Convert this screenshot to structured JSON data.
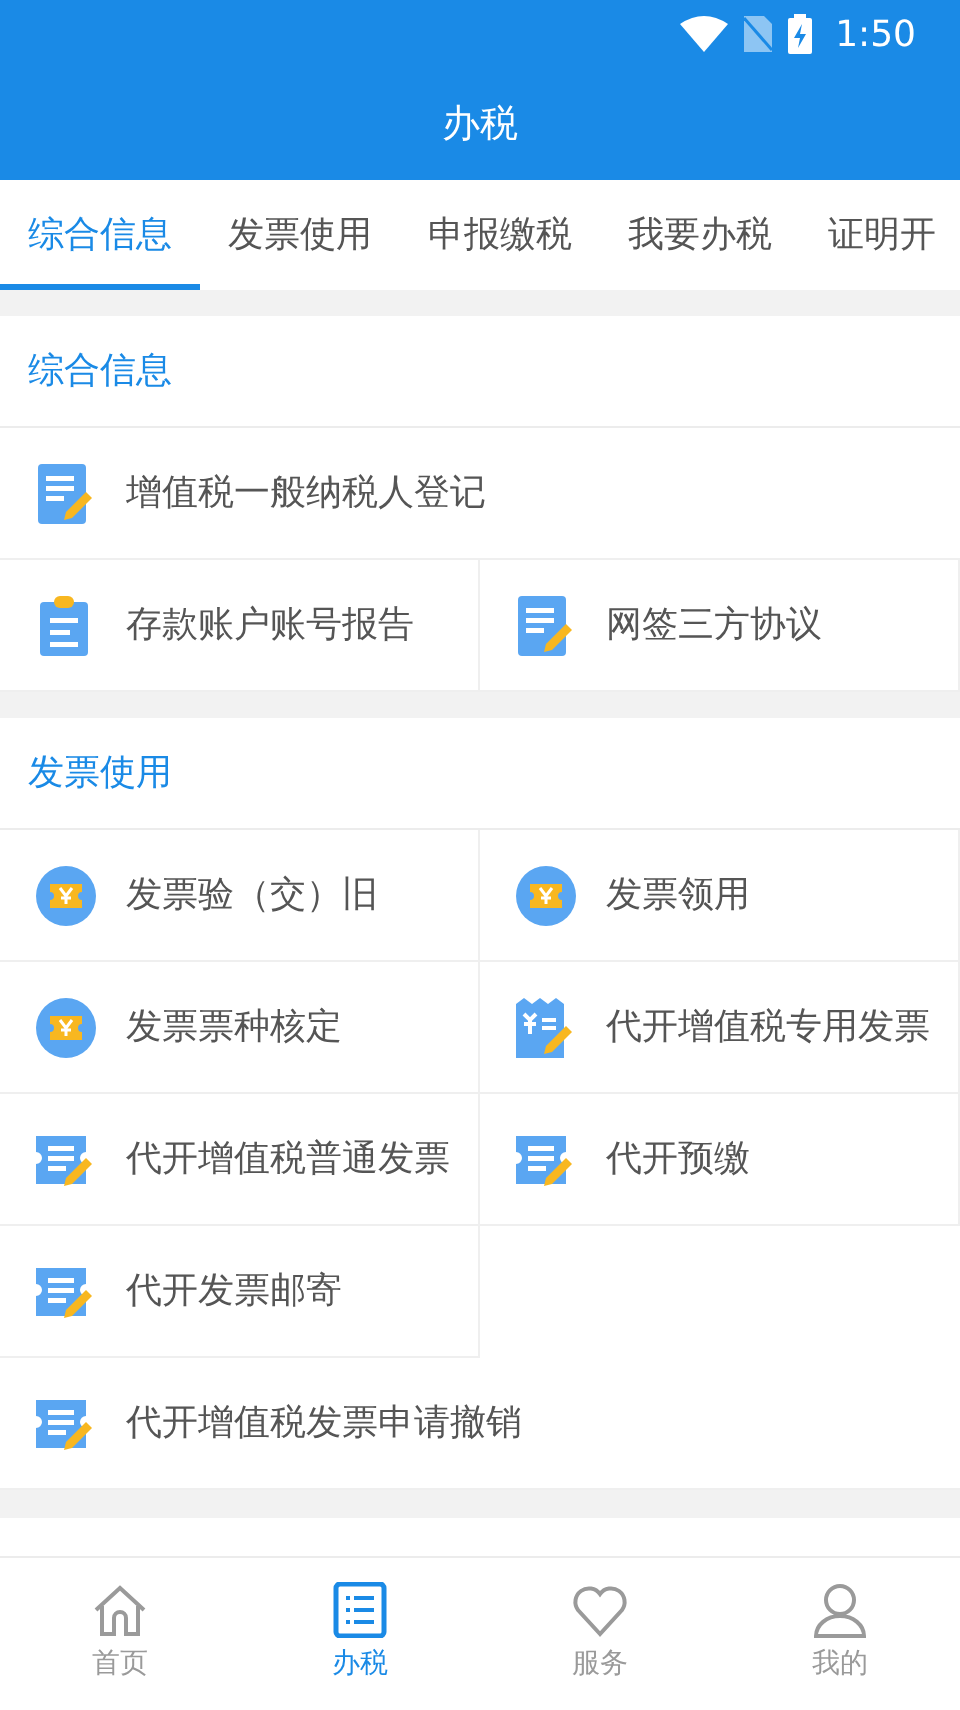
{
  "status_bar": {
    "time": "1:50"
  },
  "header": {
    "title": "办税"
  },
  "tabs": [
    {
      "label": "综合信息",
      "selected": true
    },
    {
      "label": "发票使用",
      "selected": false
    },
    {
      "label": "申报缴税",
      "selected": false
    },
    {
      "label": "我要办税",
      "selected": false
    },
    {
      "label": "证明开",
      "selected": false
    }
  ],
  "sections": [
    {
      "title": "综合信息",
      "items": [
        {
          "label": "增值税一般纳税人登记",
          "kind": "document",
          "full_width": true
        },
        {
          "label": "存款账户账号报告",
          "kind": "clipboard",
          "full_width": false
        },
        {
          "label": "网签三方协议",
          "kind": "document",
          "full_width": false
        }
      ]
    },
    {
      "title": "发票使用",
      "items": [
        {
          "label": "发票验（交）旧",
          "kind": "coin",
          "full_width": false
        },
        {
          "label": "发票领用",
          "kind": "coin",
          "full_width": false
        },
        {
          "label": "发票票种核定",
          "kind": "coin",
          "full_width": false
        },
        {
          "label": "代开增值税专用发票",
          "kind": "invoice",
          "full_width": false
        },
        {
          "label": "代开增值税普通发票",
          "kind": "ticket",
          "full_width": false
        },
        {
          "label": "代开预缴",
          "kind": "ticket",
          "full_width": false
        },
        {
          "label": "代开发票邮寄",
          "kind": "ticket",
          "full_width": false
        },
        {
          "label": "代开增值税发票申请撤销",
          "kind": "ticket",
          "full_width": true
        }
      ]
    }
  ],
  "bottom_nav": [
    {
      "label": "首页",
      "kind": "home",
      "selected": false
    },
    {
      "label": "办税",
      "kind": "list",
      "selected": true
    },
    {
      "label": "服务",
      "kind": "heart",
      "selected": false
    },
    {
      "label": "我的",
      "kind": "person",
      "selected": false
    }
  ]
}
